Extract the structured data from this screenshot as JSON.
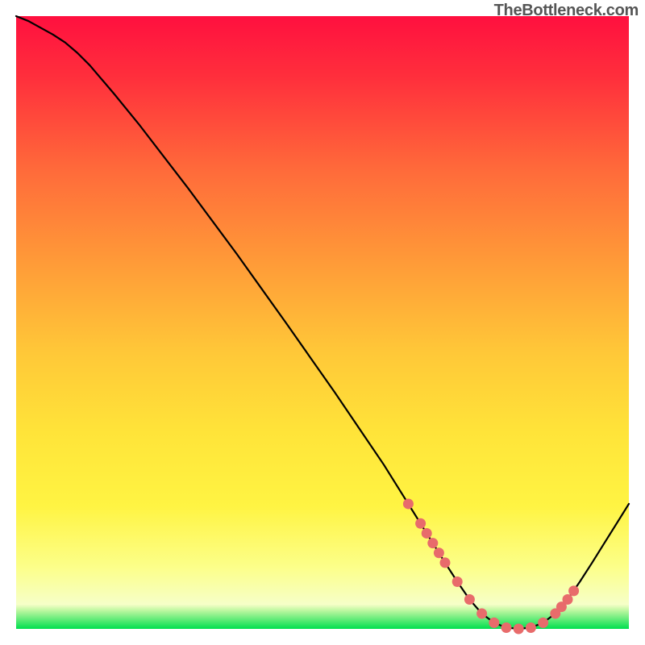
{
  "watermark": {
    "text": "TheBottleneck.com"
  },
  "chart_data": {
    "type": "line",
    "title": "",
    "xlabel": "",
    "ylabel": "",
    "xlim": [
      0,
      100
    ],
    "ylim": [
      0,
      100
    ],
    "grid": false,
    "legend": false,
    "colors": {
      "gradient_top": "#ff0d3e",
      "gradient_mid_upper": "#ff7b3a",
      "gradient_mid": "#ffc83a",
      "gradient_mid_lower": "#ffeb3a",
      "gradient_lower": "#fffb7a",
      "gradient_bottom": "#00e04e",
      "curve": "#000000",
      "marker": "#e86b6b"
    },
    "series": [
      {
        "name": "bottleneck-curve",
        "x": [
          0,
          2,
          4,
          6,
          8,
          10,
          12,
          16,
          20,
          24,
          28,
          32,
          36,
          40,
          44,
          48,
          52,
          56,
          60,
          64,
          66,
          68,
          70,
          72,
          74,
          76,
          78,
          80,
          82,
          84,
          86,
          88,
          90,
          92,
          94,
          96,
          98,
          100
        ],
        "y": [
          100,
          99.2,
          98.1,
          97.0,
          95.7,
          94.0,
          92.0,
          87.3,
          82.4,
          77.2,
          72.0,
          66.6,
          61.2,
          55.6,
          50.0,
          44.3,
          38.6,
          32.7,
          26.8,
          20.4,
          17.2,
          14.0,
          10.8,
          7.7,
          4.8,
          2.5,
          1.0,
          0.2,
          0.0,
          0.2,
          1.0,
          2.5,
          4.8,
          7.7,
          10.8,
          14.0,
          17.2,
          20.4
        ]
      }
    ],
    "markers": {
      "name": "valley-dots",
      "x": [
        64,
        66,
        67,
        68,
        69,
        70,
        72,
        74,
        76,
        78,
        80,
        82,
        84,
        86,
        88,
        89,
        90,
        91
      ],
      "y": [
        20.4,
        17.2,
        15.6,
        14.0,
        12.4,
        10.8,
        7.7,
        4.8,
        2.5,
        1.0,
        0.2,
        0.0,
        0.2,
        1.0,
        2.5,
        3.6,
        4.8,
        6.2
      ]
    },
    "annotations": []
  }
}
